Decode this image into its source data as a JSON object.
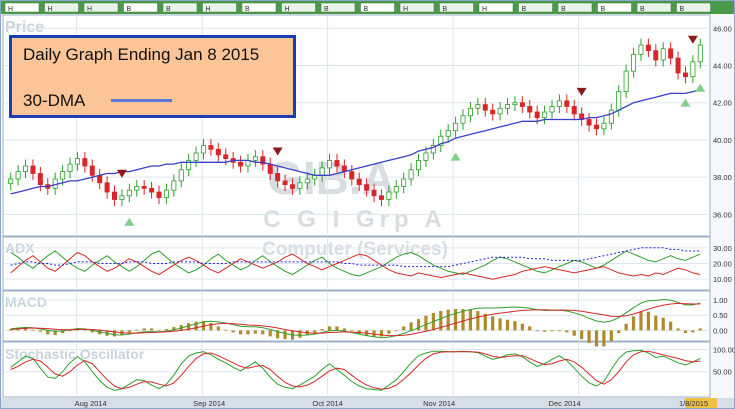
{
  "markers": [
    "H",
    "H",
    "H",
    "B",
    "B",
    "H",
    "B",
    "H",
    "B",
    "B",
    "H",
    "B",
    "H",
    "B",
    "B",
    "B",
    "B",
    "B"
  ],
  "legend": {
    "title": "Daily Graph Ending Jan 8 2015",
    "ma_label": "30-DMA",
    "ma_color": "#5b78d6"
  },
  "watermark": {
    "symbol": "GIB.A",
    "name": "C G I Grp A",
    "sector": "Computer (Services)"
  },
  "colors": {
    "up": "#2ca02c",
    "down": "#d62728",
    "ma": "#3a3fc8",
    "bg": "#f6f8fb",
    "plot_bg": "#ffffff",
    "grid": "#dde6ee",
    "sell_arrow": "#8b1a1a",
    "buy_arrow": "#7fd18a",
    "macd_hist": "#b08a2a"
  },
  "chart_data": [
    {
      "type": "candlestick",
      "title": "Price",
      "ylim": [
        35,
        46.5
      ],
      "y_ticks": [
        "46.00",
        "44.00",
        "42.00",
        "40.00",
        "38.00",
        "36.00"
      ],
      "x_ticks": [
        "Aug 2014",
        "Sep 2014",
        "Oct 2014",
        "Nov 2014",
        "Dec 2014",
        "1/8/2015"
      ],
      "close": [
        37.9,
        38.3,
        38.6,
        38.2,
        37.6,
        37.4,
        37.9,
        38.3,
        38.7,
        39.0,
        38.6,
        38.1,
        37.7,
        37.2,
        36.8,
        37.0,
        37.3,
        37.5,
        37.4,
        37.2,
        36.9,
        37.3,
        37.8,
        38.4,
        38.9,
        39.3,
        39.7,
        39.5,
        39.2,
        39.0,
        38.8,
        38.6,
        38.9,
        39.1,
        38.7,
        38.2,
        37.8,
        37.6,
        37.4,
        37.7,
        37.9,
        38.1,
        38.5,
        38.9,
        38.6,
        38.3,
        37.9,
        37.6,
        37.3,
        37.0,
        36.8,
        37.2,
        37.5,
        37.9,
        38.4,
        38.9,
        39.3,
        39.7,
        40.2,
        40.5,
        40.9,
        41.3,
        41.7,
        41.9,
        41.6,
        41.4,
        41.7,
        41.9,
        42.0,
        41.8,
        41.5,
        41.2,
        41.5,
        41.8,
        42.1,
        41.8,
        41.4,
        41.1,
        40.8,
        40.6,
        40.9,
        41.6,
        42.6,
        43.7,
        44.6,
        45.1,
        44.8,
        44.3,
        44.9,
        44.4,
        43.6,
        43.4,
        44.2,
        45.1
      ],
      "ma_30": [
        37.1,
        37.2,
        37.3,
        37.4,
        37.5,
        37.5,
        37.6,
        37.7,
        37.8,
        37.8,
        37.9,
        38.0,
        38.1,
        38.2,
        38.2,
        38.3,
        38.3,
        38.4,
        38.5,
        38.6,
        38.6,
        38.7,
        38.7,
        38.8,
        38.8,
        38.8,
        38.8,
        38.8,
        38.8,
        38.8,
        38.9,
        38.9,
        38.9,
        38.8,
        38.8,
        38.7,
        38.6,
        38.5,
        38.4,
        38.3,
        38.2,
        38.1,
        38.1,
        38.1,
        38.2,
        38.3,
        38.4,
        38.5,
        38.6,
        38.7,
        38.8,
        38.9,
        39.0,
        39.1,
        39.2,
        39.4,
        39.5,
        39.6,
        39.8,
        39.9,
        40.1,
        40.2,
        40.3,
        40.4,
        40.5,
        40.6,
        40.7,
        40.8,
        40.9,
        41.0,
        41.0,
        41.0,
        41.1,
        41.1,
        41.1,
        41.1,
        41.1,
        41.1,
        41.2,
        41.2,
        41.3,
        41.4,
        41.6,
        41.8,
        42.0,
        42.1,
        42.2,
        42.3,
        42.4,
        42.5,
        42.5,
        42.5,
        42.6,
        42.7
      ],
      "sell_signals": [
        15,
        36,
        77,
        92
      ],
      "buy_signals": [
        16,
        60,
        91,
        93
      ]
    },
    {
      "type": "line",
      "title": "ADX",
      "ylim": [
        5,
        35
      ],
      "y_ticks": [
        "30.00",
        "20.00",
        "10.00"
      ],
      "series": [
        {
          "color": "#2ca02c",
          "values": [
            27,
            24,
            20,
            17,
            21,
            25,
            28,
            24,
            20,
            17,
            15,
            19,
            22,
            25,
            21,
            18,
            15,
            18,
            22,
            26,
            28,
            24,
            20,
            17,
            14,
            16,
            19,
            23,
            26,
            22,
            19,
            16,
            18,
            22,
            25,
            21,
            18,
            15,
            13,
            16,
            19,
            22,
            24,
            20,
            17,
            15,
            13,
            12,
            14,
            16,
            18,
            21,
            24,
            26,
            27,
            25,
            22,
            19,
            17,
            15,
            14,
            13,
            15,
            17,
            19,
            22,
            24,
            23,
            21,
            19,
            17,
            15,
            14,
            16,
            18,
            20,
            22,
            21,
            19,
            17,
            19,
            22,
            25,
            28,
            26,
            24,
            22,
            21,
            23,
            25,
            23,
            22,
            24,
            26
          ]
        },
        {
          "color": "#d62728",
          "values": [
            14,
            18,
            22,
            25,
            21,
            17,
            15,
            19,
            23,
            27,
            25,
            21,
            18,
            15,
            17,
            20,
            23,
            21,
            18,
            15,
            13,
            16,
            19,
            22,
            24,
            22,
            19,
            16,
            14,
            17,
            20,
            23,
            21,
            19,
            17,
            19,
            21,
            24,
            26,
            23,
            20,
            18,
            16,
            18,
            20,
            22,
            24,
            26,
            25,
            22,
            19,
            16,
            14,
            13,
            12,
            14,
            13,
            12,
            11,
            12,
            13,
            14,
            13,
            12,
            11,
            10,
            11,
            12,
            13,
            15,
            16,
            17,
            18,
            17,
            16,
            15,
            14,
            15,
            16,
            17,
            18,
            16,
            14,
            13,
            12,
            13,
            12,
            14,
            13,
            15,
            17,
            16,
            14,
            13
          ]
        },
        {
          "color": "#2020d0",
          "dashed": true,
          "values": [
            19,
            20,
            21,
            21,
            20,
            20,
            19,
            19,
            20,
            21,
            21,
            21,
            20,
            20,
            20,
            20,
            21,
            21,
            21,
            20,
            20,
            20,
            21,
            21,
            21,
            21,
            20,
            20,
            20,
            20,
            21,
            21,
            21,
            21,
            21,
            21,
            21,
            21,
            21,
            21,
            21,
            21,
            21,
            21,
            21,
            20,
            20,
            19,
            19,
            19,
            19,
            19,
            19,
            18,
            18,
            18,
            18,
            18,
            18,
            18,
            19,
            20,
            21,
            22,
            23,
            24,
            24,
            24,
            24,
            24,
            23,
            23,
            23,
            22,
            22,
            22,
            22,
            22,
            23,
            24,
            25,
            26,
            27,
            28,
            29,
            30,
            30,
            30,
            30,
            29,
            29,
            28,
            28,
            28
          ]
        }
      ]
    },
    {
      "type": "line",
      "title": "MACD",
      "ylim": [
        -0.25,
        1.2
      ],
      "y_ticks": [
        "1.00",
        "0.50",
        "0.00"
      ],
      "series": [
        {
          "color": "#2ca02c",
          "values": [
            0.05,
            0.08,
            0.1,
            0.09,
            0.05,
            0.0,
            -0.03,
            -0.02,
            0.02,
            0.06,
            0.05,
            0.0,
            -0.05,
            -0.1,
            -0.14,
            -0.15,
            -0.12,
            -0.08,
            -0.05,
            -0.04,
            -0.05,
            -0.03,
            0.02,
            0.08,
            0.15,
            0.22,
            0.28,
            0.3,
            0.28,
            0.24,
            0.19,
            0.14,
            0.12,
            0.12,
            0.09,
            0.03,
            -0.04,
            -0.1,
            -0.15,
            -0.16,
            -0.15,
            -0.12,
            -0.07,
            -0.01,
            0.0,
            -0.02,
            -0.07,
            -0.12,
            -0.17,
            -0.21,
            -0.24,
            -0.22,
            -0.17,
            -0.1,
            -0.01,
            0.09,
            0.19,
            0.29,
            0.39,
            0.48,
            0.56,
            0.63,
            0.69,
            0.73,
            0.74,
            0.74,
            0.75,
            0.76,
            0.77,
            0.76,
            0.73,
            0.68,
            0.66,
            0.66,
            0.67,
            0.64,
            0.58,
            0.5,
            0.4,
            0.31,
            0.27,
            0.31,
            0.42,
            0.58,
            0.75,
            0.9,
            0.98,
            0.99,
            1.02,
            1.0,
            0.92,
            0.84,
            0.84,
            0.9
          ]
        },
        {
          "color": "#d62728",
          "values": [
            0.03,
            0.05,
            0.07,
            0.08,
            0.07,
            0.06,
            0.04,
            0.02,
            0.02,
            0.03,
            0.04,
            0.03,
            0.01,
            -0.02,
            -0.05,
            -0.08,
            -0.09,
            -0.09,
            -0.08,
            -0.07,
            -0.06,
            -0.05,
            -0.03,
            0.0,
            0.04,
            0.09,
            0.14,
            0.19,
            0.22,
            0.23,
            0.22,
            0.2,
            0.18,
            0.17,
            0.15,
            0.12,
            0.08,
            0.03,
            -0.01,
            -0.05,
            -0.08,
            -0.09,
            -0.09,
            -0.07,
            -0.06,
            -0.05,
            -0.06,
            -0.07,
            -0.09,
            -0.12,
            -0.15,
            -0.17,
            -0.17,
            -0.16,
            -0.13,
            -0.08,
            -0.03,
            0.03,
            0.1,
            0.17,
            0.24,
            0.31,
            0.38,
            0.44,
            0.49,
            0.53,
            0.57,
            0.6,
            0.63,
            0.66,
            0.67,
            0.68,
            0.68,
            0.67,
            0.67,
            0.67,
            0.66,
            0.63,
            0.59,
            0.55,
            0.51,
            0.47,
            0.46,
            0.48,
            0.54,
            0.62,
            0.7,
            0.77,
            0.83,
            0.87,
            0.89,
            0.88,
            0.87,
            0.87
          ]
        }
      ]
    },
    {
      "type": "line",
      "title": "Stochastic Oscillator",
      "ylim": [
        0,
        110
      ],
      "y_ticks": [
        "100.00",
        "50.00"
      ],
      "series": [
        {
          "color": "#2ca02c",
          "values": [
            60,
            72,
            85,
            80,
            58,
            38,
            35,
            50,
            70,
            84,
            72,
            50,
            30,
            15,
            8,
            12,
            22,
            32,
            30,
            20,
            12,
            22,
            42,
            68,
            85,
            92,
            95,
            88,
            78,
            70,
            60,
            52,
            62,
            72,
            58,
            38,
            22,
            15,
            12,
            20,
            30,
            40,
            55,
            68,
            55,
            42,
            28,
            18,
            12,
            10,
            8,
            20,
            32,
            50,
            70,
            86,
            92,
            96,
            96,
            95,
            95,
            96,
            95,
            93,
            85,
            78,
            82,
            88,
            90,
            84,
            72,
            62,
            68,
            78,
            86,
            75,
            58,
            40,
            25,
            18,
            28,
            55,
            80,
            94,
            97,
            98,
            92,
            82,
            85,
            78,
            70,
            65,
            72,
            80
          ]
        },
        {
          "color": "#d62728",
          "values": [
            55,
            62,
            72,
            78,
            74,
            60,
            45,
            40,
            50,
            65,
            75,
            68,
            50,
            32,
            18,
            12,
            15,
            22,
            28,
            27,
            22,
            18,
            25,
            42,
            62,
            80,
            90,
            92,
            86,
            78,
            70,
            62,
            58,
            62,
            64,
            55,
            40,
            26,
            18,
            16,
            20,
            28,
            40,
            52,
            58,
            55,
            42,
            30,
            20,
            14,
            11,
            13,
            20,
            33,
            48,
            65,
            80,
            90,
            94,
            95,
            95,
            95,
            95,
            94,
            90,
            85,
            82,
            84,
            86,
            86,
            80,
            72,
            66,
            68,
            74,
            78,
            72,
            60,
            45,
            30,
            22,
            32,
            50,
            72,
            88,
            95,
            96,
            92,
            88,
            84,
            80,
            75,
            72,
            74
          ]
        }
      ]
    }
  ]
}
